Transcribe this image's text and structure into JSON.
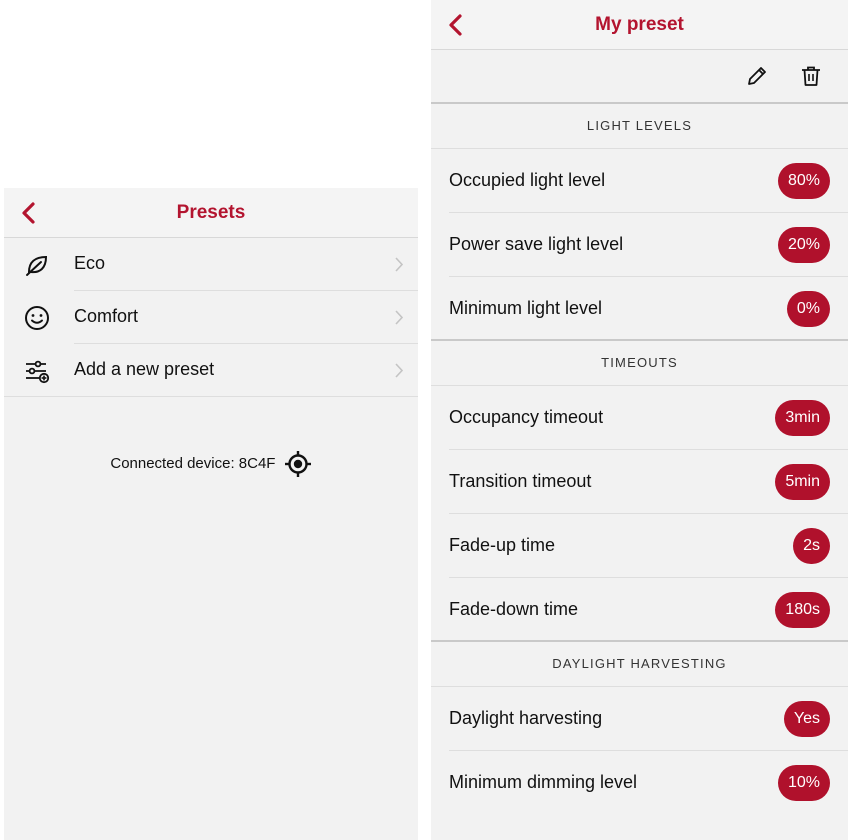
{
  "presets_screen": {
    "title": "Presets",
    "items": [
      {
        "label": "Eco",
        "icon": "leaf-icon"
      },
      {
        "label": "Comfort",
        "icon": "smiley-icon"
      },
      {
        "label": "Add a new preset",
        "icon": "sliders-add-icon"
      }
    ],
    "device_status": "Connected device: 8C4F",
    "accent_color": "#b3142f"
  },
  "preset_detail": {
    "title": "My preset",
    "sections": [
      {
        "header": "LIGHT LEVELS",
        "rows": [
          {
            "label": "Occupied light level",
            "value": "80%"
          },
          {
            "label": "Power save light level",
            "value": "20%"
          },
          {
            "label": "Minimum light level",
            "value": "0%"
          }
        ]
      },
      {
        "header": "TIMEOUTS",
        "rows": [
          {
            "label": "Occupancy timeout",
            "value": "3min"
          },
          {
            "label": "Transition timeout",
            "value": "5min"
          },
          {
            "label": "Fade-up time",
            "value": "2s"
          },
          {
            "label": "Fade-down time",
            "value": "180s"
          }
        ]
      },
      {
        "header": "DAYLIGHT HARVESTING",
        "rows": [
          {
            "label": "Daylight harvesting",
            "value": "Yes"
          },
          {
            "label": "Minimum dimming level",
            "value": "10%"
          }
        ]
      }
    ]
  }
}
